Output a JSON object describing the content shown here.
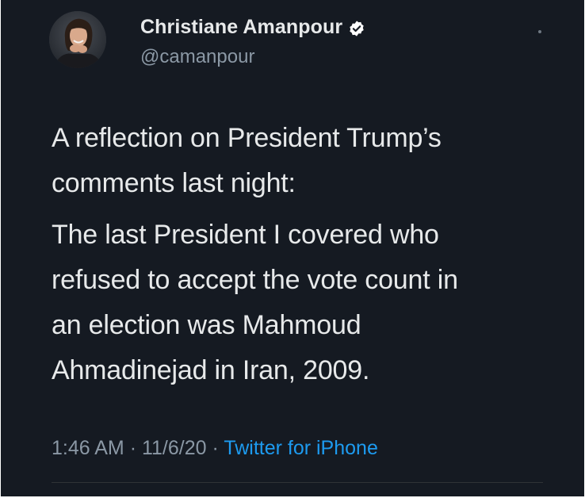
{
  "author": {
    "display_name": "Christiane Amanpour",
    "handle": "@camanpour",
    "verified": true,
    "avatar_icon": "profile-photo"
  },
  "tweet": {
    "paragraphs": [
      [
        "A reflection on President Trump’s",
        "comments last night:"
      ],
      [
        "The last President I covered who",
        "refused to accept the vote count in",
        "an election was Mahmoud",
        "Ahmadinejad in Iran, 2009."
      ]
    ]
  },
  "meta": {
    "time": "1:46 AM",
    "separator": "·",
    "date": "11/6/20",
    "source": "Twitter for iPhone"
  },
  "colors": {
    "background": "#151a22",
    "text": "#e7e9ea",
    "secondary_text": "#8b98a5",
    "link": "#1d9bf0"
  }
}
